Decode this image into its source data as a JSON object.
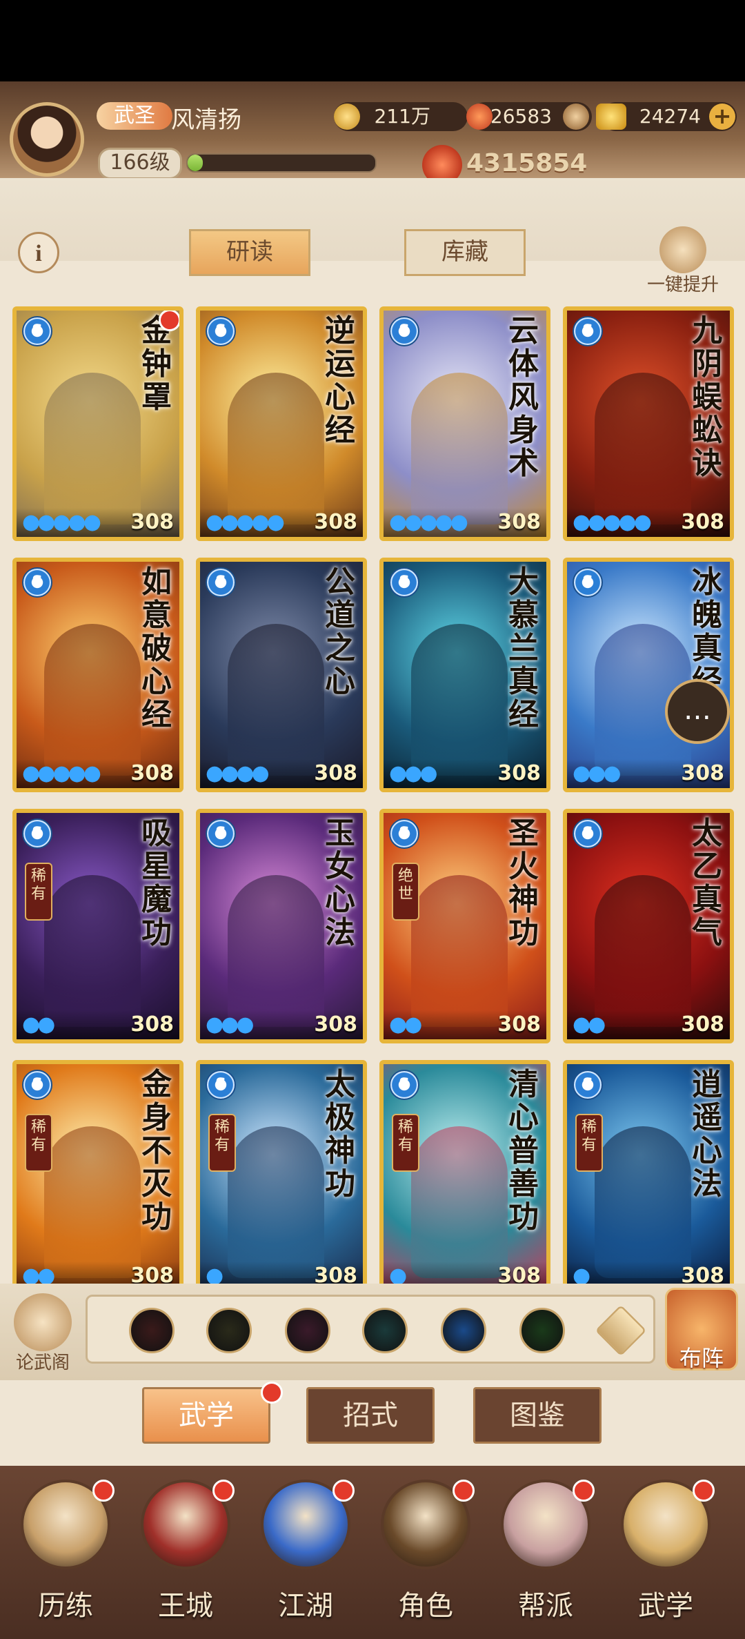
{
  "player": {
    "rank": "武圣",
    "name": "风清扬",
    "level": "166级",
    "exp_fraction": 0.08,
    "power": "4315854"
  },
  "resources": {
    "coins": "211万",
    "ingots_red": "126583",
    "gold": "24274"
  },
  "tabs": {
    "study": "研读",
    "store": "库藏",
    "one_key_upgrade": "一键提升",
    "info": "i"
  },
  "cards": [
    {
      "title": "金钟罩",
      "level": "308",
      "dots": "●●●●●",
      "rarity": "",
      "red_dot": true,
      "art": [
        "#c9a24a",
        "#f3d98a",
        "#7b6a52"
      ]
    },
    {
      "title": "逆运心经",
      "level": "308",
      "dots": "●●●●●",
      "rarity": "",
      "red_dot": false,
      "art": [
        "#d08a2a",
        "#fff0a0",
        "#6b3a1a"
      ]
    },
    {
      "title": "云体风身术",
      "level": "308",
      "dots": "●●●●●",
      "rarity": "",
      "red_dot": false,
      "art": [
        "#8d8ec8",
        "#e6e6f6",
        "#c58a2c"
      ]
    },
    {
      "title": "九阴蜈蚣诀",
      "level": "308",
      "dots": "●●●●●",
      "rarity": "",
      "red_dot": false,
      "art": [
        "#8a2010",
        "#e0512a",
        "#3a0f0a"
      ]
    },
    {
      "title": "如意破心经",
      "level": "308",
      "dots": "●●●●●",
      "rarity": "",
      "red_dot": false,
      "art": [
        "#c85a1a",
        "#ffd070",
        "#6b2a10"
      ]
    },
    {
      "title": "公道之心",
      "level": "308",
      "dots": "●●●●",
      "rarity": "",
      "red_dot": false,
      "art": [
        "#2a3a5a",
        "#7e8aa8",
        "#1a1a2a"
      ]
    },
    {
      "title": "大慕兰真经",
      "level": "308",
      "dots": "●●●",
      "rarity": "",
      "red_dot": false,
      "art": [
        "#1a5a7a",
        "#5fd6e6",
        "#0a2030"
      ]
    },
    {
      "title": "冰魄真经",
      "level": "308",
      "dots": "●●●",
      "rarity": "",
      "red_dot": false,
      "art": [
        "#3a7ac8",
        "#cde8ff",
        "#2a3e8a"
      ]
    },
    {
      "title": "吸星魔功",
      "level": "308",
      "dots": "●●",
      "rarity": "稀有",
      "red_dot": false,
      "art": [
        "#3a1f5a",
        "#8a5ac8",
        "#1a0f2a"
      ]
    },
    {
      "title": "玉女心法",
      "level": "308",
      "dots": "●●●",
      "rarity": "",
      "red_dot": false,
      "art": [
        "#5a2a7a",
        "#d88ad8",
        "#2a1a3a"
      ]
    },
    {
      "title": "圣火神功",
      "level": "308",
      "dots": "●●",
      "rarity": "绝世",
      "red_dot": false,
      "art": [
        "#d0501a",
        "#ffd080",
        "#8a1a1a"
      ]
    },
    {
      "title": "太乙真气",
      "level": "308",
      "dots": "●●",
      "rarity": "",
      "red_dot": false,
      "art": [
        "#8a1010",
        "#e03020",
        "#2a0a0a"
      ]
    },
    {
      "title": "金身不灭功",
      "level": "308",
      "dots": "●●",
      "rarity": "稀有",
      "red_dot": false,
      "art": [
        "#e07a1a",
        "#fff0b0",
        "#8a3a10"
      ]
    },
    {
      "title": "太极神功",
      "level": "308",
      "dots": "●",
      "rarity": "稀有",
      "red_dot": false,
      "art": [
        "#2a6a9a",
        "#cfe8ff",
        "#1a2a4a"
      ]
    },
    {
      "title": "清心普善功",
      "level": "308",
      "dots": "●",
      "rarity": "稀有",
      "red_dot": false,
      "art": [
        "#2a8a9a",
        "#bff0f0",
        "#c83a5a"
      ]
    },
    {
      "title": "逍遥心法",
      "level": "308",
      "dots": "●",
      "rarity": "稀有",
      "red_dot": false,
      "art": [
        "#1a5a9a",
        "#7ec8f0",
        "#0a1a3a"
      ]
    }
  ],
  "skill_bar": {
    "lun_wu_ge": "论武阁",
    "bu_zhen": "布阵",
    "slots": [
      {
        "icon": "sword-icon",
        "color": "#3a1a1a"
      },
      {
        "icon": "shield-icon",
        "color": "#2a2a1a"
      },
      {
        "icon": "fist-icon",
        "color": "#3a1a2a"
      },
      {
        "icon": "fan-icon",
        "color": "#1a3a3a"
      },
      {
        "icon": "s-spiral-icon",
        "color": "#1a4a8a"
      },
      {
        "icon": "gourd-icon",
        "color": "#1a3a1a"
      },
      {
        "icon": "arrow-up-icon",
        "color": "#c9a56b"
      }
    ]
  },
  "sub_tabs": {
    "martial": "武学",
    "moves": "招式",
    "atlas": "图鉴"
  },
  "nav": [
    {
      "label": "历练",
      "icon": "scroll-icon",
      "color": "#c8a06a"
    },
    {
      "label": "王城",
      "icon": "palace-icon",
      "color": "#a0302a"
    },
    {
      "label": "江湖",
      "icon": "sword-icon",
      "color": "#3a6ac8"
    },
    {
      "label": "角色",
      "icon": "hat-warrior-icon",
      "color": "#6a4a2a"
    },
    {
      "label": "帮派",
      "icon": "gang-seal-icon",
      "color": "#c8a0a0"
    },
    {
      "label": "武学",
      "icon": "scrolls-icon",
      "color": "#d8b06a"
    }
  ]
}
